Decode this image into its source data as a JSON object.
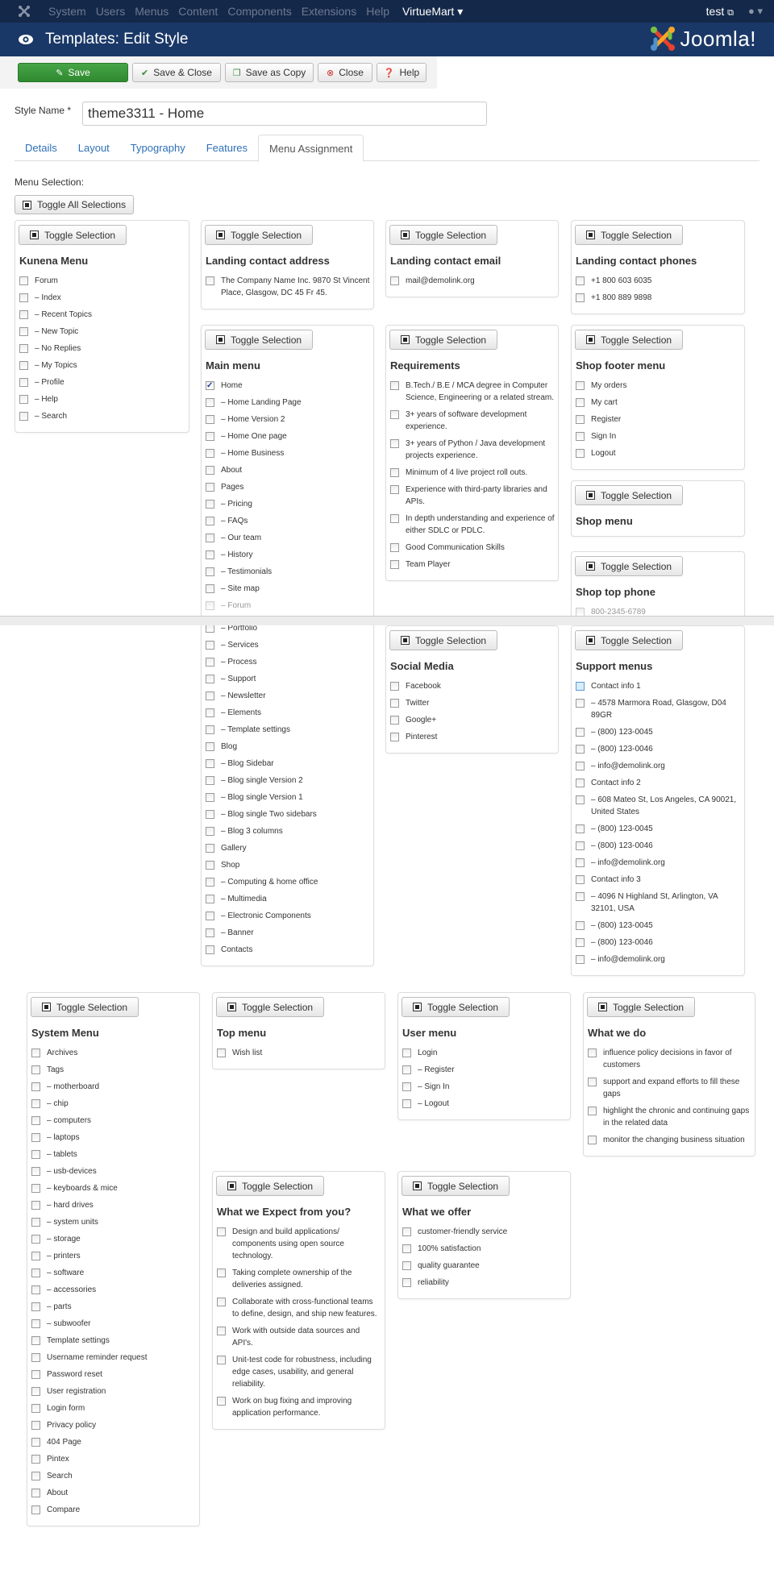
{
  "navbar": {
    "items": [
      "System",
      "Users",
      "Menus",
      "Content",
      "Components",
      "Extensions",
      "Help"
    ],
    "virtuemart": "VirtueMart ▾",
    "user": "test",
    "user_link_icon": "external-link-icon",
    "user_menu_icon": "user-icon"
  },
  "header": {
    "title": "Templates: Edit Style",
    "brand": "Joomla!",
    "icon": "eye-icon"
  },
  "toolbar": {
    "save": "Save",
    "save_close": "Save & Close",
    "save_copy": "Save as Copy",
    "close": "Close",
    "help": "Help",
    "colors": {
      "save": "#3e9a3e",
      "close_icon": "#c9302c"
    }
  },
  "form": {
    "style_name_label": "Style Name *",
    "style_name_value": "theme3311 - Home"
  },
  "tabs": [
    "Details",
    "Layout",
    "Typography",
    "Features",
    "Menu Assignment"
  ],
  "active_tab": "Menu Assignment",
  "menu_selection_label": "Menu Selection:",
  "toggle_all": "Toggle All Selections",
  "toggle_label": "Toggle Selection",
  "menus": {
    "kunena": {
      "title": "Kunena Menu",
      "items": [
        {
          "label": "Forum"
        },
        {
          "label": "– Index"
        },
        {
          "label": "– Recent Topics"
        },
        {
          "label": "– New Topic"
        },
        {
          "label": "– No Replies"
        },
        {
          "label": "– My Topics"
        },
        {
          "label": "– Profile"
        },
        {
          "label": "– Help"
        },
        {
          "label": "– Search"
        }
      ]
    },
    "landing_address": {
      "title": "Landing contact address",
      "items": [
        {
          "label": "The Company Name Inc. 9870 St Vincent Place, Glasgow, DC 45 Fr 45."
        }
      ]
    },
    "landing_email": {
      "title": "Landing contact email",
      "items": [
        {
          "label": "mail@demolink.org"
        }
      ]
    },
    "landing_phones": {
      "title": "Landing contact phones",
      "items": [
        {
          "label": "+1 800 603 6035"
        },
        {
          "label": "+1 800 889 9898"
        }
      ]
    },
    "main": {
      "title": "Main menu",
      "items": [
        {
          "label": "Home",
          "checked": true
        },
        {
          "label": "– Home Landing Page"
        },
        {
          "label": "– Home Version 2"
        },
        {
          "label": "– Home One page"
        },
        {
          "label": "– Home Business"
        },
        {
          "label": "About"
        },
        {
          "label": "Pages"
        },
        {
          "label": "– Pricing"
        },
        {
          "label": "– FAQs"
        },
        {
          "label": "– Our team"
        },
        {
          "label": "– History"
        },
        {
          "label": "– Testimonials"
        },
        {
          "label": "– Site map"
        },
        {
          "label": "– Forum"
        }
      ],
      "items_after": [
        {
          "label": "– Portfolio"
        },
        {
          "label": "– Services"
        },
        {
          "label": "– Process"
        },
        {
          "label": "– Support"
        },
        {
          "label": "– Newsletter"
        },
        {
          "label": "– Elements"
        },
        {
          "label": "– Template settings"
        },
        {
          "label": "Blog"
        },
        {
          "label": "– Blog Sidebar"
        },
        {
          "label": "– Blog single Version 2"
        },
        {
          "label": "– Blog single Version 1"
        },
        {
          "label": "– Blog single Two sidebars"
        },
        {
          "label": "– Blog 3 columns"
        },
        {
          "label": "Gallery"
        },
        {
          "label": "Shop"
        },
        {
          "label": "– Computing & home office"
        },
        {
          "label": "– Multimedia"
        },
        {
          "label": "– Electronic Components"
        },
        {
          "label": "– Banner"
        },
        {
          "label": "Contacts"
        }
      ]
    },
    "requirements": {
      "title": "Requirements",
      "items": [
        {
          "label": "B.Tech./ B.E / MCA degree in Computer Science, Engineering or a related stream."
        },
        {
          "label": "3+ years of software development experience."
        },
        {
          "label": "3+ years of Python / Java development projects experience."
        },
        {
          "label": "Minimum of 4 live project roll outs."
        },
        {
          "label": "Experience with third-party libraries and APIs."
        },
        {
          "label": "In depth understanding and experience of either SDLC or PDLC."
        },
        {
          "label": "Good Communication Skills"
        },
        {
          "label": "Team Player"
        }
      ]
    },
    "shop_footer": {
      "title": "Shop footer menu",
      "items": [
        {
          "label": "My orders"
        },
        {
          "label": "My cart"
        },
        {
          "label": "Register"
        },
        {
          "label": "Sign In"
        },
        {
          "label": "Logout"
        }
      ]
    },
    "shop_menu": {
      "title": "Shop menu",
      "items": []
    },
    "shop_top_phone": {
      "title": "Shop top phone",
      "items": [
        {
          "label": "800-2345-6789"
        }
      ]
    },
    "social": {
      "title": "Social Media",
      "items": [
        {
          "label": "Facebook"
        },
        {
          "label": "Twitter"
        },
        {
          "label": "Google+"
        },
        {
          "label": "Pinterest"
        }
      ]
    },
    "support": {
      "title": "Support menus",
      "items": [
        {
          "label": "Contact info 1",
          "focus": true
        },
        {
          "label": "– 4578 Marmora Road, Glasgow, D04 89GR"
        },
        {
          "label": "– (800) 123-0045"
        },
        {
          "label": "– (800) 123-0046"
        },
        {
          "label": "– info@demolink.org"
        },
        {
          "label": "Contact info 2"
        },
        {
          "label": "– 608 Mateo St, Los Angeles, CA 90021, United States"
        },
        {
          "label": "– (800) 123-0045"
        },
        {
          "label": "– (800) 123-0046"
        },
        {
          "label": "– info@demolink.org"
        },
        {
          "label": "Contact info 3"
        },
        {
          "label": "– 4096 N Highland St, Arlington, VA 32101, USA"
        },
        {
          "label": "– (800) 123-0045"
        },
        {
          "label": "– (800) 123-0046"
        },
        {
          "label": "– info@demolink.org"
        }
      ]
    },
    "system": {
      "title": "System Menu",
      "items": [
        {
          "label": "Archives"
        },
        {
          "label": "Tags"
        },
        {
          "label": "– motherboard"
        },
        {
          "label": "– chip"
        },
        {
          "label": "– computers"
        },
        {
          "label": "– laptops"
        },
        {
          "label": "– tablets"
        },
        {
          "label": "– usb-devices"
        },
        {
          "label": "– keyboards & mice"
        },
        {
          "label": "– hard drives"
        },
        {
          "label": "– system units"
        },
        {
          "label": "– storage"
        },
        {
          "label": "– printers"
        },
        {
          "label": "– software"
        },
        {
          "label": "– accessories"
        },
        {
          "label": "– parts"
        },
        {
          "label": "– subwoofer"
        },
        {
          "label": "Template settings"
        },
        {
          "label": "Username reminder request"
        },
        {
          "label": "Password reset"
        },
        {
          "label": "User registration"
        },
        {
          "label": "Login form"
        },
        {
          "label": "Privacy policy"
        },
        {
          "label": "404 Page"
        },
        {
          "label": "Pintex"
        },
        {
          "label": "Search"
        },
        {
          "label": "About"
        },
        {
          "label": "Compare"
        }
      ]
    },
    "top": {
      "title": "Top menu",
      "items": [
        {
          "label": "Wish list"
        }
      ]
    },
    "user": {
      "title": "User menu",
      "items": [
        {
          "label": "Login"
        },
        {
          "label": "– Register"
        },
        {
          "label": "– Sign In"
        },
        {
          "label": "– Logout"
        }
      ]
    },
    "whatwedo": {
      "title": "What we do",
      "items": [
        {
          "label": "influence policy decisions in favor of customers"
        },
        {
          "label": "support and expand efforts to fill these gaps"
        },
        {
          "label": "highlight the chronic and continuing gaps in the related data"
        },
        {
          "label": "monitor the changing business situation"
        }
      ]
    },
    "expect": {
      "title": "What we Expect from you?",
      "items": [
        {
          "label": "Design and build applications/ components using open source technology."
        },
        {
          "label": "Taking complete ownership of the deliveries assigned."
        },
        {
          "label": "Collaborate with cross-functional teams to define, design, and ship new features."
        },
        {
          "label": "Work with outside data sources and API's."
        },
        {
          "label": "Unit-test code for robustness, including edge cases, usability, and general reliability."
        },
        {
          "label": "Work on bug fixing and improving application performance."
        }
      ]
    },
    "offer": {
      "title": "What we offer",
      "items": [
        {
          "label": "customer-friendly service"
        },
        {
          "label": "100% satisfaction"
        },
        {
          "label": "quality guarantee"
        },
        {
          "label": "reliability"
        }
      ]
    }
  }
}
